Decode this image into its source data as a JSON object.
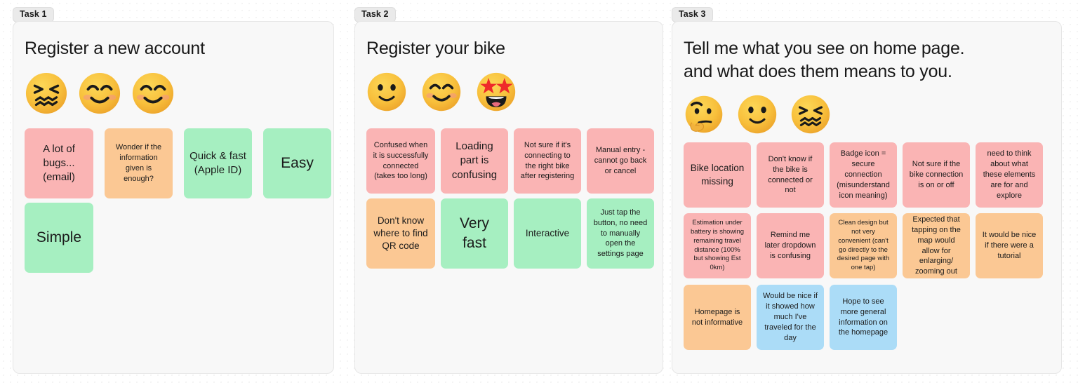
{
  "board": {
    "background_color": "#ffffff",
    "dot_color": "#dcdcdc",
    "frame_fill": "#f8f8f8",
    "frame_border": "#e6e6e6"
  },
  "palette": {
    "pink": "#fab4b4",
    "orange": "#fbc894",
    "green": "#a6efc1",
    "blue": "#abdcf7"
  },
  "frames": [
    {
      "label": "Task 1",
      "title": "Register a new account",
      "emojis": [
        {
          "name": "confounded-face-emoji",
          "glyph": "😖"
        },
        {
          "name": "smiling-face-with-smiling-eyes-emoji",
          "glyph": "😊"
        },
        {
          "name": "smiling-face-with-smiling-eyes-emoji",
          "glyph": "😊"
        }
      ],
      "notes": [
        {
          "text": "A lot of bugs... (email)",
          "color": "pink",
          "size": "lg"
        },
        {
          "text": "Wonder if the information given is enough?",
          "color": "orange",
          "size": "sm"
        },
        {
          "text": "Quick & fast (Apple ID)",
          "color": "green",
          "size": "lg"
        },
        {
          "text": "Easy",
          "color": "green",
          "size": "xl"
        },
        {
          "text": "Simple",
          "color": "green",
          "size": "xl"
        }
      ]
    },
    {
      "label": "Task 2",
      "title": "Register your bike",
      "emojis": [
        {
          "name": "slightly-smiling-face-emoji",
          "glyph": "🙂"
        },
        {
          "name": "smiling-face-with-smiling-eyes-emoji",
          "glyph": "😊"
        },
        {
          "name": "star-struck-emoji",
          "glyph": "🤩"
        }
      ],
      "notes": [
        {
          "text": "Confused when it is successfully connected (takes too long)",
          "color": "pink",
          "size": "sm"
        },
        {
          "text": "Loading part is confusing",
          "color": "pink",
          "size": "lg"
        },
        {
          "text": "Not sure if it's connecting to the right bike after registering",
          "color": "pink",
          "size": "sm"
        },
        {
          "text": "Manual entry - cannot go back or cancel",
          "color": "pink",
          "size": "sm"
        },
        {
          "text": "Don't know where to find QR code",
          "color": "orange",
          "size": "md"
        },
        {
          "text": "Very fast",
          "color": "green",
          "size": "xl"
        },
        {
          "text": "Interactive",
          "color": "green",
          "size": "md"
        },
        {
          "text": "Just tap the button, no need to manually open the settings page",
          "color": "green",
          "size": "sm"
        }
      ]
    },
    {
      "label": "Task 3",
      "title": "Tell me what you see on home page. and what does them means to you.",
      "emojis": [
        {
          "name": "thinking-face-emoji",
          "glyph": "🤔"
        },
        {
          "name": "slightly-smiling-face-emoji",
          "glyph": "🙂"
        },
        {
          "name": "confounded-face-emoji",
          "glyph": "😖"
        }
      ],
      "notes": [
        {
          "text": "Bike location missing",
          "color": "pink",
          "size": "md"
        },
        {
          "text": "Don't know if the bike is connected or not",
          "color": "pink",
          "size": "sm"
        },
        {
          "text": "Badge icon = secure connection (misunderstand icon meaning)",
          "color": "pink",
          "size": "sm"
        },
        {
          "text": "Not sure if the bike connection is on or off",
          "color": "pink",
          "size": "sm"
        },
        {
          "text": "need to think about what these elements are for and explore",
          "color": "pink",
          "size": "sm"
        },
        {
          "text": "Estimation under battery is showing remaining travel distance (100% but showing Est 0km)",
          "color": "pink",
          "size": "xs"
        },
        {
          "text": "Remind me later dropdown is confusing",
          "color": "pink",
          "size": "sm"
        },
        {
          "text": "Clean design but not very convenient (can't go directly to the desired page with one tap)",
          "color": "orange",
          "size": "xs"
        },
        {
          "text": "Expected that tapping on the map would allow for enlarging/ zooming out",
          "color": "orange",
          "size": "sm"
        },
        {
          "text": "It would be nice if there were a tutorial",
          "color": "orange",
          "size": "sm"
        },
        {
          "text": "Homepage is not informative",
          "color": "orange",
          "size": "sm"
        },
        {
          "text": "Would be nice if it showed how much I've traveled for the day",
          "color": "blue",
          "size": "sm"
        },
        {
          "text": "Hope to see more general information on the homepage",
          "color": "blue",
          "size": "sm"
        }
      ]
    }
  ]
}
